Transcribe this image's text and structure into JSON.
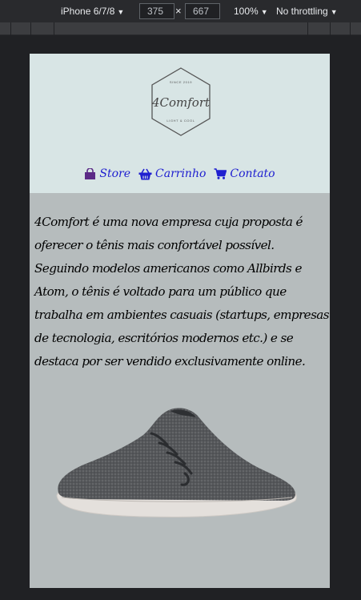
{
  "devtools": {
    "device": "iPhone 6/7/8",
    "width": "375",
    "height": "667",
    "zoom": "100%",
    "throttling": "No throttling"
  },
  "logo": {
    "top_text": "SINCE 2019",
    "brand": "4Comfort",
    "bottom_text": "LIGHT & COOL"
  },
  "nav": {
    "items": [
      {
        "label": "Store",
        "icon": "shopping-bag-icon"
      },
      {
        "label": "Carrinho",
        "icon": "shopping-basket-icon"
      },
      {
        "label": "Contato",
        "icon": "shopping-cart-icon"
      }
    ]
  },
  "content": {
    "description": "4Comfort é uma nova empresa cuja proposta é oferecer o tênis mais confortável possível. Seguindo modelos americanos como Allbirds e Atom, o tênis é voltado para um público que trabalha em ambientes casuais (startups, empresas de tecnologia, escritórios modernos etc.) e se destaca por ser vendido exclusivamente online."
  },
  "colors": {
    "header_bg": "#d8e5e5",
    "content_bg": "#b6bcbd",
    "nav_link": "#2020d0",
    "page_bg": "#202124"
  }
}
